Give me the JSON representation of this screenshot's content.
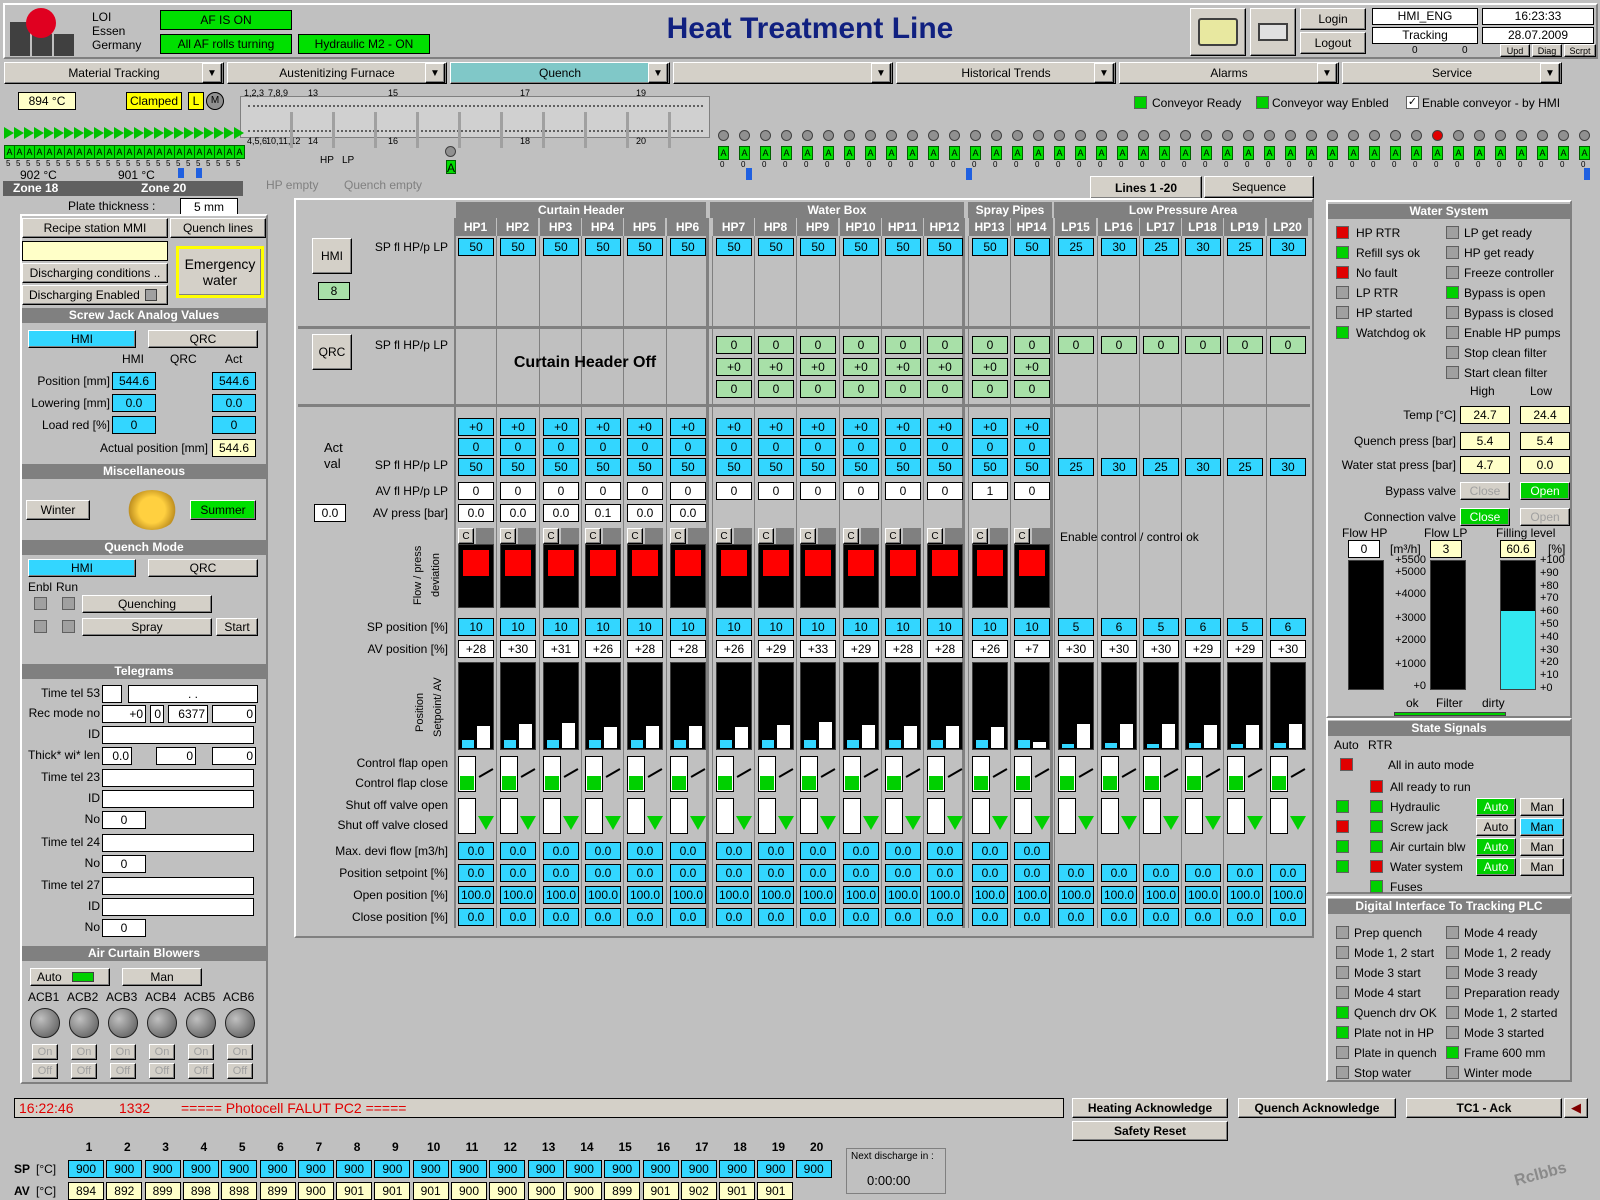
{
  "header": {
    "company": [
      "LOI",
      "Essen",
      "Germany"
    ],
    "af_on": "AF IS ON",
    "af_rolls": "All AF rolls turning",
    "hydraulic": "Hydraulic M2 - ON",
    "title": "Heat Treatment Line",
    "login": "Login",
    "logout": "Logout",
    "user": "HMI_ENG",
    "mode": "Tracking",
    "time": "16:23:33",
    "date": "28.07.2009",
    "c1": "0",
    "c2": "0",
    "upd": "Upd",
    "diag": "Diag",
    "scrpt": "Scrpt"
  },
  "nav": [
    "Material Tracking",
    "Austenitizing Furnace",
    "Quench",
    "",
    "Historical Trends",
    "Alarms",
    "Service"
  ],
  "conveyor": {
    "temp": "894 °C",
    "clamped": "Clamped",
    "l": "L",
    "m": "M",
    "t1": "902 °C",
    "t2": "901 °C",
    "zone18": "Zone 18",
    "zone20": "Zone 20",
    "hp_empty": "HP empty",
    "quench_empty": "Quench empty",
    "hp": "HP",
    "lp": "LP",
    "marks": [
      "1,2,3",
      "4,5,6",
      "7,8,9",
      "10,11,12",
      "13",
      "14",
      "15",
      "16",
      "17",
      "18",
      "19",
      "20"
    ],
    "ready": "Conveyor Ready",
    "way": "Conveyor way Enbled",
    "enable": "Enable conveyor - by HMI",
    "plate_label": "Plate thickness :",
    "plate_val": "5 mm",
    "a": "A",
    "five": "5",
    "zero": "0"
  },
  "tabs": {
    "lines": "Lines 1 -20",
    "sequence": "Sequence"
  },
  "left": {
    "recipe": "Recipe station MMI",
    "quench_lines": "Quench lines",
    "discharging": "Discharging conditions ..",
    "discharging_en": "Discharging Enabled",
    "emergency": "Emergency water",
    "sj_title": "Screw Jack Analog Values",
    "hmi": "HMI",
    "qrc": "QRC",
    "act": "Act",
    "position": "Position [mm]",
    "pos_hmi": "544.6",
    "pos_act": "544.6",
    "lowering": "Lowering [mm]",
    "low_hmi": "0.0",
    "low_act": "0.0",
    "load": "Load red [%]",
    "load_hmi": "0",
    "load_act": "0",
    "actual_pos": "Actual position [mm]",
    "actual_val": "544.6",
    "misc_title": "Miscellaneous",
    "winter": "Winter",
    "summer": "Summer",
    "qm_title": "Quench Mode",
    "enbl": "Enbl",
    "run": "Run",
    "quenching": "Quenching",
    "spray": "Spray",
    "start": "Start",
    "tel_title": "Telegrams",
    "tel53": "Time tel 53",
    "rec": "Rec mode no",
    "rec1": "+0",
    "rec2": "0",
    "rec3": "6377",
    "rec4": "0",
    "id": "ID",
    "thick": "Thick* wi* len",
    "th1": "0.0",
    "th2": "0",
    "th3": "0",
    "tel23": "Time tel 23",
    "no": "No",
    "no_val": "0",
    "tel24": "Time tel 24",
    "tel27": "Time tel 27",
    "dots": ". .",
    "acb_title": "Air Curtain Blowers",
    "auto": "Auto",
    "man": "Man",
    "acb": [
      "ACB1",
      "ACB2",
      "ACB3",
      "ACB4",
      "ACB5",
      "ACB6"
    ],
    "on": "On",
    "off": "Off"
  },
  "grid": {
    "groups": [
      "Curtain Header",
      "Water Box",
      "Spray Pipes",
      "Low Pressure Area"
    ],
    "cols": [
      "HP1",
      "HP2",
      "HP3",
      "HP4",
      "HP5",
      "HP6",
      "HP7",
      "HP8",
      "HP9",
      "HP10",
      "HP11",
      "HP12",
      "HP13",
      "HP14",
      "LP15",
      "LP16",
      "LP17",
      "LP18",
      "LP19",
      "LP20"
    ],
    "hmi": "HMI",
    "hmi_val": "8",
    "qrc": "QRC",
    "sp_label": "SP fl HP/p LP",
    "sp_hmi": [
      "50",
      "50",
      "50",
      "50",
      "50",
      "50",
      "50",
      "50",
      "50",
      "50",
      "50",
      "50",
      "50",
      "50",
      "25",
      "30",
      "25",
      "30",
      "25",
      "30"
    ],
    "curtain_off": "Curtain Header Off",
    "qrc_zero": "0",
    "qrc_plus": "+0",
    "act_val": [
      "Act",
      "val"
    ],
    "plus0": "+0",
    "zero": "0",
    "sp_act": [
      "50",
      "50",
      "50",
      "50",
      "50",
      "50",
      "50",
      "50",
      "50",
      "50",
      "50",
      "50",
      "50",
      "50",
      "25",
      "30",
      "25",
      "30",
      "25",
      "30"
    ],
    "av_label": "AV fl HP/p LP",
    "av_vals": [
      "0",
      "0",
      "0",
      "0",
      "0",
      "0",
      "0",
      "0",
      "0",
      "0",
      "0",
      "0",
      "1",
      "0"
    ],
    "av_press_label": "AV press [bar]",
    "av_press_left": "0.0",
    "av_press": [
      "0.0",
      "0.0",
      "0.0",
      "0.1",
      "0.0",
      "0.0"
    ],
    "c": "C",
    "enable_ctrl": "Enable control / control ok",
    "flow_dev": [
      "Flow / press",
      "deviation"
    ],
    "sp_pos_label": "SP position [%]",
    "sp_pos": [
      "10",
      "10",
      "10",
      "10",
      "10",
      "10",
      "10",
      "10",
      "10",
      "10",
      "10",
      "10",
      "10",
      "10",
      "5",
      "6",
      "5",
      "6",
      "5",
      "6"
    ],
    "av_pos_label": "AV position [%]",
    "av_pos": [
      "+28",
      "+30",
      "+31",
      "+26",
      "+28",
      "+28",
      "+26",
      "+29",
      "+33",
      "+29",
      "+28",
      "+28",
      "+26",
      "+7",
      "+30",
      "+30",
      "+30",
      "+29",
      "+29",
      "+30"
    ],
    "pos_sp_av": [
      "Position",
      "Setpoint/ AV"
    ],
    "cf_open": "Control flap open",
    "cf_close": "Control flap close",
    "sv_open": "Shut off valve open",
    "sv_closed": "Shut off valve closed",
    "max_devi": "Max. devi flow [m3/h]",
    "pos_setpoint": "Position setpoint [%]",
    "open_pos": "Open position [%]",
    "close_pos": "Close position [%]",
    "v00": "0.0",
    "v100": "100.0"
  },
  "water": {
    "title": "Water System",
    "left": [
      "HP RTR",
      "Refill sys ok",
      "No fault",
      "LP RTR",
      "HP started",
      "Watchdog ok"
    ],
    "right": [
      "LP get ready",
      "HP get ready",
      "Freeze controller",
      "Bypass is open",
      "Bypass is closed",
      "Enable HP pumps",
      "Stop clean filter",
      "Start clean filter"
    ],
    "high": "High",
    "low": "Low",
    "temp": "Temp [°C]",
    "temp_h": "24.7",
    "temp_l": "24.4",
    "qpress": "Quench press [bar]",
    "qp_h": "5.4",
    "qp_l": "5.4",
    "wpress": "Water stat press [bar]",
    "wp_h": "4.7",
    "wp_l": "0.0",
    "bypass": "Bypass valve",
    "close": "Close",
    "open": "Open",
    "conn": "Connection valve",
    "flow_hp": "Flow HP",
    "flow_lp": "Flow LP",
    "fill": "Filling level",
    "fhp": "0",
    "unit": "[m³/h]",
    "flp": "3",
    "fill_val": "60.6",
    "pct": "[%]",
    "scale_hp": [
      "+5500",
      "+5000",
      "+4000",
      "+3000",
      "+2000",
      "+1000",
      "+0"
    ],
    "scale_fill": [
      "+100",
      "+90",
      "+80",
      "+70",
      "+60",
      "+50",
      "+40",
      "+30",
      "+20",
      "+10",
      "+0"
    ],
    "fill_level": 0.606,
    "ok": "ok",
    "filter": "Filter",
    "dirty": "dirty"
  },
  "state": {
    "title": "State Signals",
    "auto": "Auto",
    "rtr": "RTR",
    "rows": [
      "All in auto mode",
      "All ready to run",
      "Hydraulic",
      "Screw jack",
      "Air curtain blw",
      "Water system",
      "Fuses"
    ],
    "auto_btn": "Auto",
    "man_btn": "Man"
  },
  "digital": {
    "title": "Digital Interface To Tracking PLC",
    "left": [
      "Prep quench",
      "Mode 1, 2 start",
      "Mode 3 start",
      "Mode 4 start",
      "Quench drv OK",
      "Plate not in HP",
      "Plate in quench",
      "Stop water"
    ],
    "right": [
      "Mode 4 ready",
      "Mode 1, 2 ready",
      "Mode 3 ready",
      "Preparation ready",
      "Mode 1, 2  started",
      "Mode 3  started",
      "Frame 600 mm",
      "Winter mode"
    ]
  },
  "bottom": {
    "alarm_time": "16:22:46",
    "alarm_code": "1332",
    "alarm_msg": "=====  Photocell FALUT PC2  =====",
    "heat_ack": "Heating Acknowledge",
    "quench_ack": "Quench Acknowledge",
    "tc1": "TC1 - Ack",
    "safety": "Safety Reset",
    "sp": "SP",
    "av": "AV",
    "unit": "[°C]",
    "zones": [
      "1",
      "2",
      "3",
      "4",
      "5",
      "6",
      "7",
      "8",
      "9",
      "10",
      "11",
      "12",
      "13",
      "14",
      "15",
      "16",
      "17",
      "18",
      "19",
      "20"
    ],
    "sp_vals": [
      "900",
      "900",
      "900",
      "900",
      "900",
      "900",
      "900",
      "900",
      "900",
      "900",
      "900",
      "900",
      "900",
      "900",
      "900",
      "900",
      "900",
      "900",
      "900",
      "900"
    ],
    "av_vals": [
      "894",
      "892",
      "899",
      "898",
      "898",
      "899",
      "900",
      "901",
      "901",
      "901",
      "900",
      "900",
      "900",
      "900",
      "899",
      "901",
      "902",
      "901",
      "901"
    ],
    "next": "Next discharge in :",
    "next_val": "0:00:00",
    "watermark": "Rclbbs"
  }
}
